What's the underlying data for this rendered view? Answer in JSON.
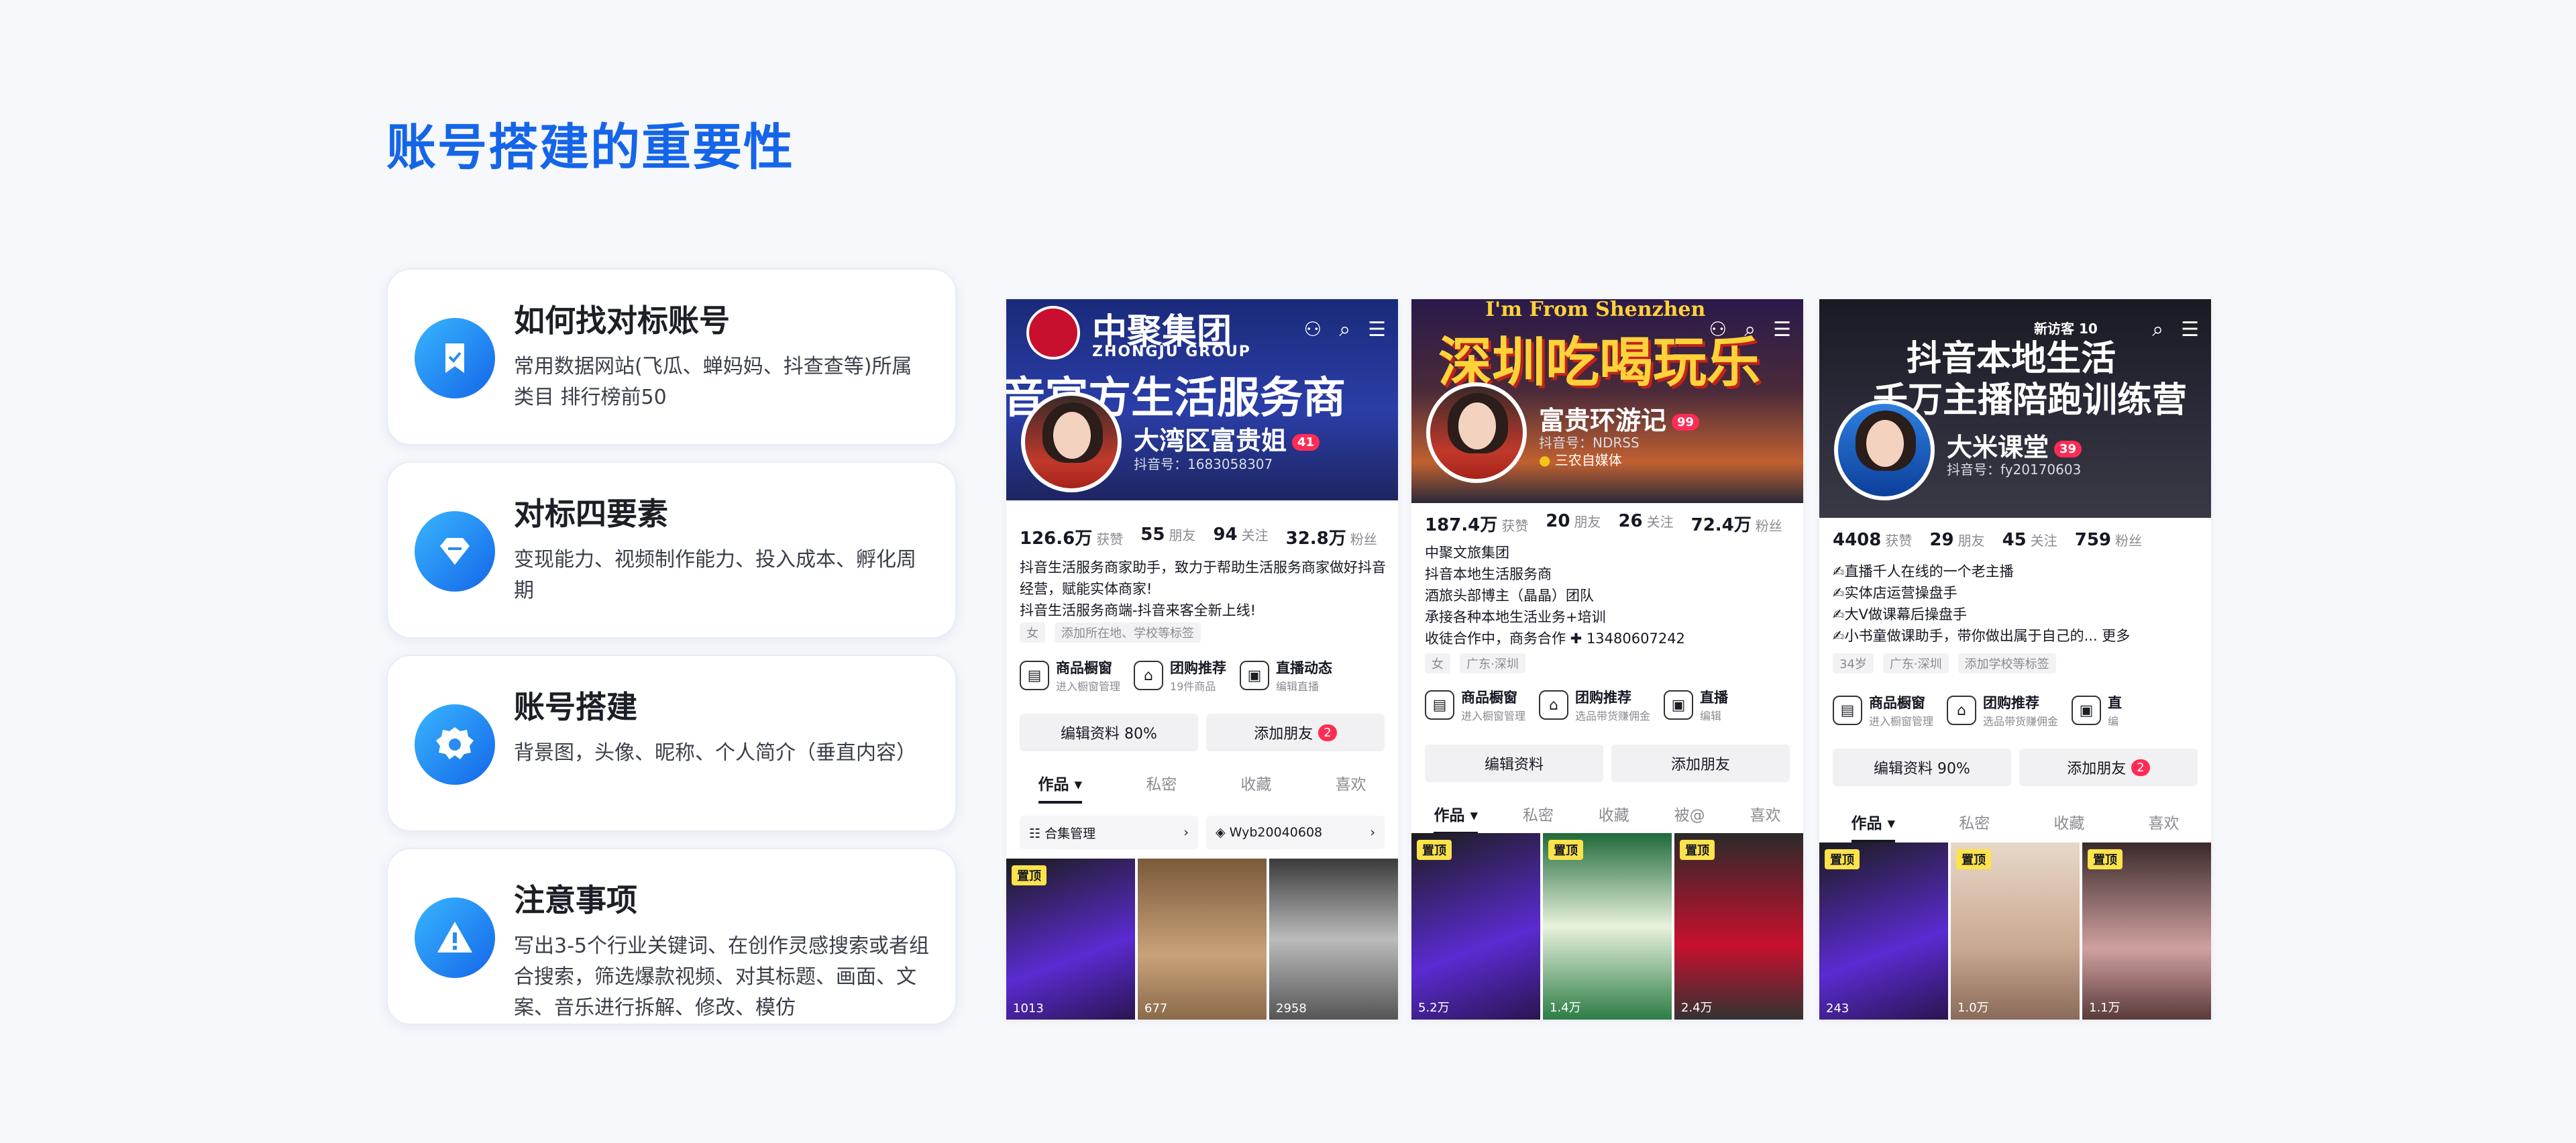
{
  "title": "账号搭建的重要性",
  "cards": [
    {
      "icon": "bookmark-icon",
      "title": "如何找对标账号",
      "desc": "常用数据网站(飞瓜、蝉妈妈、抖查查等)所属类目 排行榜前50"
    },
    {
      "icon": "diamond-icon",
      "title": "对标四要素",
      "desc": "变现能力、视频制作能力、投入成本、孵化周期"
    },
    {
      "icon": "gear-icon",
      "title": "账号搭建",
      "desc": "背景图，头像、昵称、个人简介（垂直内容）"
    },
    {
      "icon": "warning-icon",
      "title": "注意事项",
      "desc": "写出3-5个行业关键词、在创作灵感搜索或者组合搜索，筛选爆款视频、对其标题、画面、文案、音乐进行拆解、修改、模仿"
    }
  ],
  "phones": [
    {
      "banner_line1": "中聚集团",
      "banner_line1b": "ZHONGJU GROUP",
      "banner_line2": "音官方生活服务商",
      "name": "大湾区富贵姐",
      "badge": "41",
      "id": "抖音号：1683058307",
      "stats": [
        {
          "v": "126.6万",
          "l": "获赞"
        },
        {
          "v": "55",
          "l": "朋友"
        },
        {
          "v": "94",
          "l": "关注"
        },
        {
          "v": "32.8万",
          "l": "粉丝"
        }
      ],
      "bio": [
        "抖音生活服务商家助手，致力于帮助生活服务商家做好抖音",
        "经营，赋能实体商家!",
        "抖音生活服务商端-抖音来客全新上线!"
      ],
      "tags": [
        "女",
        "添加所在地、学校等标签"
      ],
      "tools": [
        {
          "name": "商品橱窗",
          "sub": "进入橱窗管理"
        },
        {
          "name": "团购推荐",
          "sub": "19件商品"
        },
        {
          "name": "直播动态",
          "sub": "编辑直播"
        }
      ],
      "btn1": "编辑资料 80%",
      "btn2": "添加朋友",
      "btn2_badge": "2",
      "tabs": [
        "作品 ▾",
        "私密",
        "收藏",
        "喜欢"
      ],
      "sub1": "合集管理",
      "sub2": "Wyb20040608",
      "views": [
        "1013",
        "677",
        "2958"
      ]
    },
    {
      "banner_line1": "I'm From Shenzhen",
      "banner_line2": "深圳吃喝玩乐",
      "name": "富贵环游记",
      "badge": "99",
      "id": "抖音号：NDRSS",
      "tag1": "三农自媒体",
      "stats": [
        {
          "v": "187.4万",
          "l": "获赞"
        },
        {
          "v": "20",
          "l": "朋友"
        },
        {
          "v": "26",
          "l": "关注"
        },
        {
          "v": "72.4万",
          "l": "粉丝"
        }
      ],
      "bio": [
        "中聚文旅集团",
        "抖音本地生活服务商",
        "酒旅头部博主（晶晶）团队",
        "承接各种本地生活业务+培训",
        "收徒合作中，商务合作 ✚ 13480607242"
      ],
      "tags": [
        "女",
        "广东·深圳"
      ],
      "tools": [
        {
          "name": "商品橱窗",
          "sub": "进入橱窗管理"
        },
        {
          "name": "团购推荐",
          "sub": "选品带货赚佣金"
        },
        {
          "name": "直播",
          "sub": "编辑"
        }
      ],
      "btn1": "编辑资料",
      "btn2": "添加朋友",
      "tabs": [
        "作品 ▾",
        "私密",
        "收藏",
        "被@",
        "喜欢"
      ],
      "views": [
        "5.2万",
        "1.4万",
        "2.4万"
      ]
    },
    {
      "banner_top": "新访客 10",
      "banner_line1": "抖音本地生活",
      "banner_line2": "千万主播陪跑训练营",
      "name": "大米课堂",
      "badge": "39",
      "id": "抖音号：fy20170603",
      "stats": [
        {
          "v": "4408",
          "l": "获赞"
        },
        {
          "v": "29",
          "l": "朋友"
        },
        {
          "v": "45",
          "l": "关注"
        },
        {
          "v": "759",
          "l": "粉丝"
        }
      ],
      "bio": [
        "✍直播千人在线的一个老主播",
        "✍实体店运营操盘手",
        "✍大V做课幕后操盘手",
        "✍小书童做课助手，带你做出属于自己的... 更多"
      ],
      "tags": [
        "34岁",
        "广东·深圳",
        "添加学校等标签"
      ],
      "tools": [
        {
          "name": "商品橱窗",
          "sub": "进入橱窗管理"
        },
        {
          "name": "团购推荐",
          "sub": "选品带货赚佣金"
        },
        {
          "name": "直",
          "sub": "编"
        }
      ],
      "btn1": "编辑资料 90%",
      "btn2": "添加朋友",
      "btn2_badge": "2",
      "tabs": [
        "作品 ▾",
        "私密",
        "收藏",
        "喜欢"
      ],
      "views": [
        "243",
        "1.0万",
        "1.1万"
      ]
    }
  ],
  "pin_label": "置顶",
  "colors": {
    "accent": "#1565e8",
    "red": "#fe2c55"
  }
}
